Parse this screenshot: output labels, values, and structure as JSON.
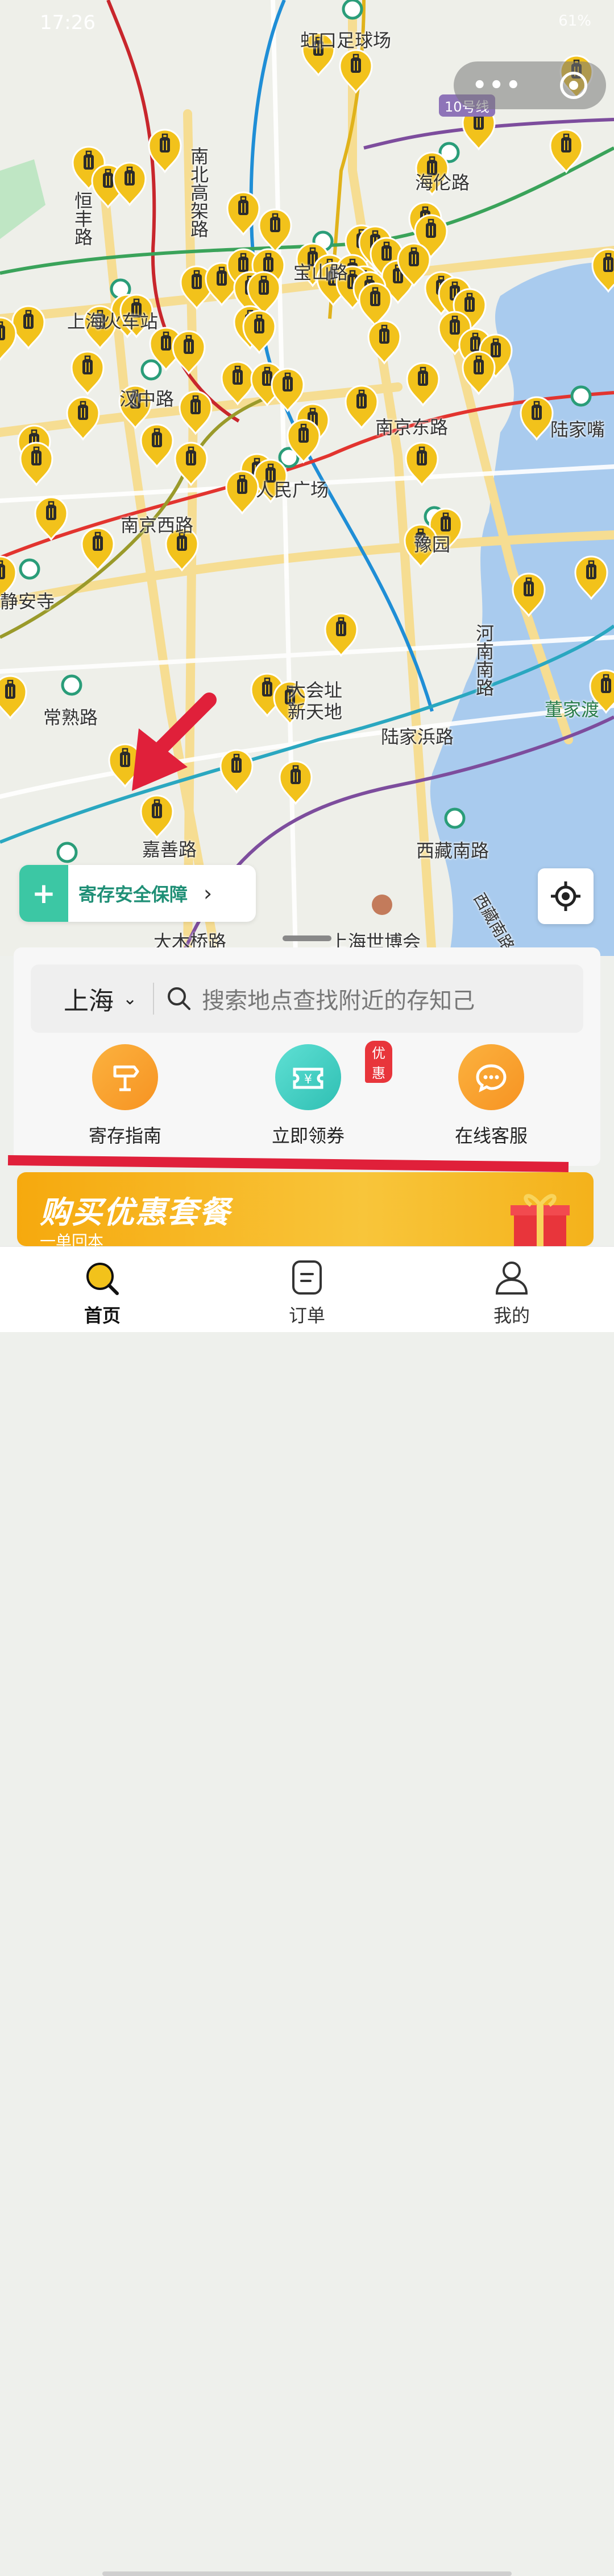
{
  "status_bar": {
    "time": "17:26",
    "right": "61%"
  },
  "capsule": {
    "more": "•••"
  },
  "map": {
    "labels": [
      "虹口足球场",
      "10号线",
      "海伦路",
      "南北高架路",
      "恒丰路",
      "宝山路",
      "上海火车站",
      "汉中路",
      "南京东路",
      "陆家嘴",
      "人民广场",
      "南京西路",
      "豫园",
      "静安寺",
      "河南南路",
      "大会址",
      "新天地",
      "常熟路",
      "董家渡",
      "陆家浜路",
      "嘉善路",
      "西藏南路",
      "大木桥路",
      "上海世博会",
      "西藏南路"
    ],
    "marker_count": 88
  },
  "safety": {
    "label": "寄存安全保障",
    "chevron": "›"
  },
  "search": {
    "city": "上海",
    "caret": "⌄",
    "placeholder": "搜索地点查找附近的存知己"
  },
  "quick_actions": [
    {
      "label": "寄存指南"
    },
    {
      "label": "立即领券",
      "badge": "优惠"
    },
    {
      "label": "在线客服"
    }
  ],
  "banner": {
    "title": "购买优惠套餐",
    "subtitle": "一单回本"
  },
  "tabs": [
    {
      "label": "首页"
    },
    {
      "label": "订单"
    },
    {
      "label": "我的"
    }
  ],
  "colors": {
    "brand_yellow": "#f2c21b",
    "marker_dark": "#2b2b2b",
    "teal": "#3cc7a4",
    "accent_red": "#e0203a"
  }
}
